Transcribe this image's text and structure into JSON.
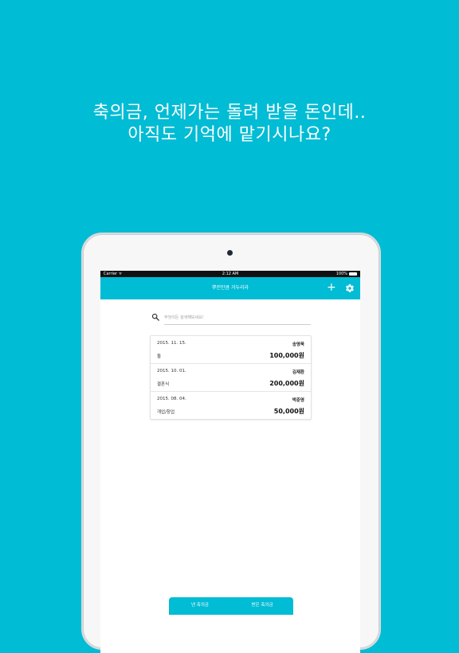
{
  "headline": {
    "line1": "축의금, 언제가는 돌려 받을 돈인데..",
    "line2": "아직도 기억에 맡기시나요?"
  },
  "statusbar": {
    "carrier": "Carrier ᯤ",
    "time": "2:12 AM",
    "battery": "100%"
  },
  "navbar": {
    "title": "뿌린만큼 거두리라",
    "add_icon": "plus-icon",
    "settings_icon": "gear-icon"
  },
  "search": {
    "placeholder": "무엇이든 검색해보세요!",
    "icon": "search-icon"
  },
  "records": [
    {
      "date": "2015. 11. 15.",
      "name": "송영욱",
      "type": "돌",
      "amount": "100,000원"
    },
    {
      "date": "2015. 10. 01.",
      "name": "김재환",
      "type": "결혼식",
      "amount": "200,000원"
    },
    {
      "date": "2015. 08. 04.",
      "name": "박준영",
      "type": "개업/창업",
      "amount": "50,000원"
    }
  ],
  "tabs": [
    {
      "label": "낸 축의금"
    },
    {
      "label": "받은 축의금"
    }
  ],
  "colors": {
    "accent": "#00bcd4",
    "background": "#00bcd4"
  }
}
